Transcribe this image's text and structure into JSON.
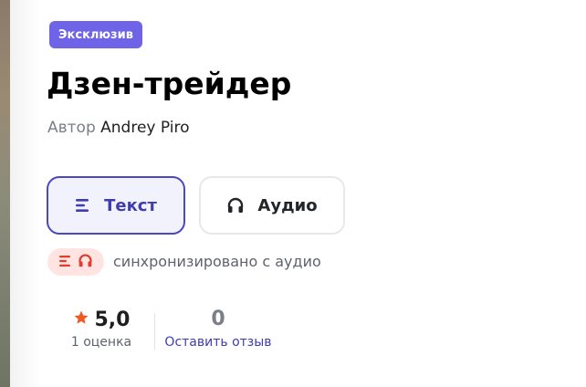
{
  "book": {
    "badge": "Эксклюзив",
    "title": "Дзен-трейдер",
    "author_label": "Автор",
    "author_name": "Andrey Piro"
  },
  "formats": {
    "text_label": "Текст",
    "text_icon": "text-lines-icon",
    "audio_label": "Аудио",
    "audio_icon": "headphones-icon",
    "selected": "text"
  },
  "sync": {
    "label": "синхронизировано с аудио",
    "icons": [
      "text-lines-icon",
      "headphones-icon"
    ]
  },
  "rating": {
    "value": "5,0",
    "count_label": "1 оценка",
    "icon": "star-icon"
  },
  "reviews": {
    "count": "0",
    "action_label": "Оставить отзыв"
  },
  "colors": {
    "badge_bg": "#6f63e8",
    "accent": "#4b48c2",
    "star": "#f05a22",
    "sync_icon": "#e23c2d",
    "sync_bg": "#ffe4e1"
  }
}
